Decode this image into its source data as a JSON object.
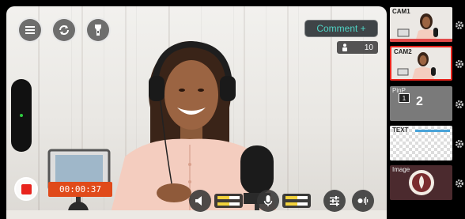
{
  "toolbar": {
    "menu_icon": "menu-icon",
    "rotate_icon": "camera-switch-icon",
    "flash_icon": "flashlight-icon"
  },
  "overlay": {
    "comment_label": "Comment +",
    "viewer_count": "10"
  },
  "recording": {
    "timer": "00:00:37"
  },
  "audio": {
    "speaker_level": 0.55,
    "mic_level": 0.55
  },
  "sidebar": {
    "sources": [
      {
        "label": "CAM1",
        "type": "camera",
        "selected": false
      },
      {
        "label": "CAM2",
        "type": "camera",
        "selected": true
      },
      {
        "label": "PinP",
        "type": "pinp",
        "number": "2",
        "badge": "1",
        "selected": false
      },
      {
        "label": "TEXT",
        "type": "text",
        "selected": false
      },
      {
        "label": "Image",
        "type": "image",
        "selected": false
      }
    ]
  },
  "colors": {
    "record": "#e8231c",
    "timer_bg": "#e04a1a",
    "accent": "#4fd3c4",
    "level": "#f2d23c"
  }
}
